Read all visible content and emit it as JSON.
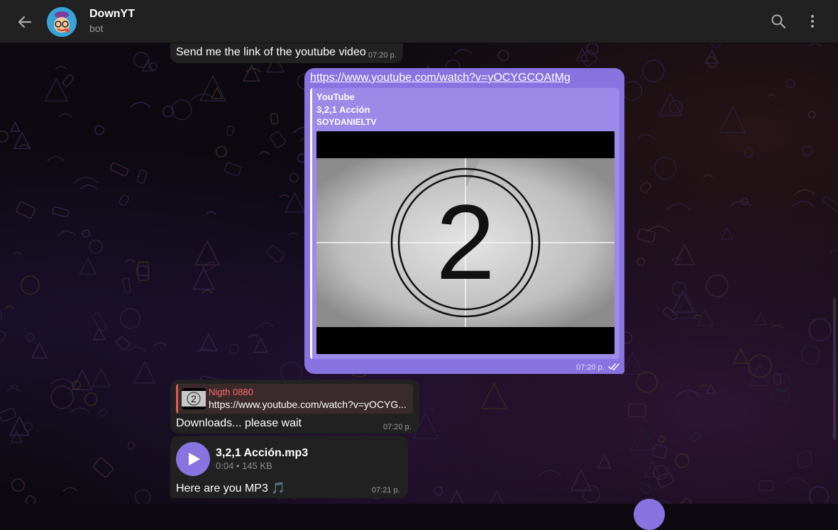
{
  "header": {
    "title": "DownYT",
    "subtitle": "bot"
  },
  "messages": {
    "prompt": {
      "text": "Send me the link of the youtube video",
      "time": "07:20 p."
    },
    "link": {
      "url": "https://www.youtube.com/watch?v=yOCYGCOAtMg",
      "preview_site": "YouTube",
      "preview_title": "3,2,1 Acción",
      "preview_description": "SOYDANIELTV",
      "thumbnail_digit": "2",
      "time": "07:20 p."
    },
    "reply": {
      "reply_name": "Nigth 0880",
      "reply_text": "https://www.youtube.com/watch?v=yOCYG...",
      "text": "Downloads... please wait",
      "time": "07:20 p."
    },
    "audio": {
      "filename": "3,2,1 Acción.mp3",
      "meta": "0:04 • 145 KB",
      "text": "Here are you MP3 🎵",
      "time": "07:21 p."
    }
  },
  "colors": {
    "accent": "#8774e1",
    "header_bg": "#212121",
    "bubble_in": "#212121",
    "reply_name": "#ff6b6b"
  },
  "icons": {
    "back": "arrow-left-icon",
    "search": "search-icon",
    "menu": "more-vertical-icon",
    "play": "play-icon",
    "read": "double-check-icon"
  }
}
